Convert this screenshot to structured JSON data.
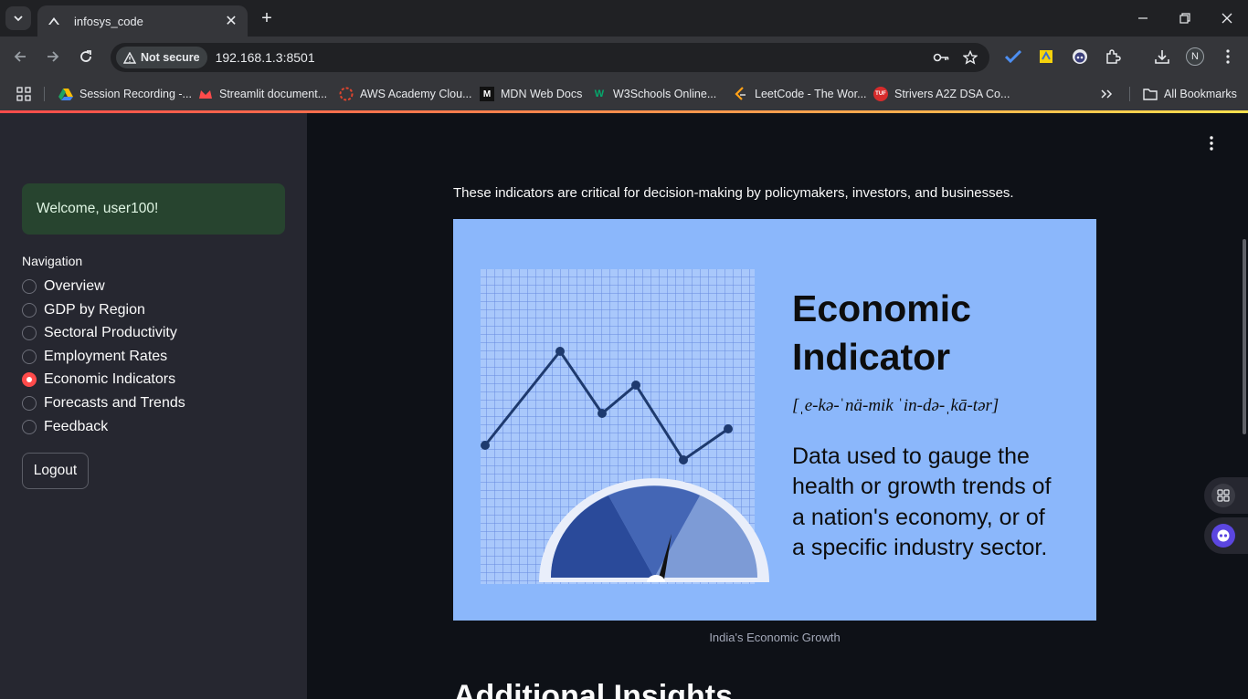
{
  "browser": {
    "tab_title": "infosys_code",
    "security_label": "Not secure",
    "url": "192.168.1.3:8501",
    "profile_initial": "N",
    "bookmarks": [
      {
        "label": "Session Recording -..."
      },
      {
        "label": "Streamlit document..."
      },
      {
        "label": "AWS Academy Clou..."
      },
      {
        "label": "MDN Web Docs"
      },
      {
        "label": "W3Schools Online..."
      },
      {
        "label": "LeetCode - The Wor..."
      },
      {
        "label": "Strivers A2Z DSA Co..."
      }
    ],
    "all_bookmarks_label": "All Bookmarks"
  },
  "sidebar": {
    "welcome_text": "Welcome, user100!",
    "nav_label": "Navigation",
    "nav_items": [
      {
        "label": "Overview",
        "selected": false
      },
      {
        "label": "GDP by Region",
        "selected": false
      },
      {
        "label": "Sectoral Productivity",
        "selected": false
      },
      {
        "label": "Employment Rates",
        "selected": false
      },
      {
        "label": "Economic Indicators",
        "selected": true
      },
      {
        "label": "Forecasts and Trends",
        "selected": false
      },
      {
        "label": "Feedback",
        "selected": false
      }
    ],
    "logout_label": "Logout"
  },
  "main": {
    "intro_text": "These indicators are critical for decision-making by policymakers, investors, and businesses.",
    "hero_image": {
      "heading_line1": "Economic",
      "heading_line2": "Indicator",
      "pronunciation": "[ˌe-kə-ˈnä-mik ˈin-də-ˌkā-tər]",
      "definition_line1": "Data used to gauge the",
      "definition_line2": "health or growth trends of",
      "definition_line3": "a nation's economy, or of",
      "definition_line4": "a specific industry sector."
    },
    "image_caption": "India's Economic Growth",
    "section_heading": "Additional Insights"
  },
  "colors": {
    "accent": "#ff4b4b",
    "sidebar_bg": "#262730",
    "main_bg": "#0e1117",
    "welcome_bg": "#27442f",
    "hero_bg": "#8bb7fb"
  }
}
